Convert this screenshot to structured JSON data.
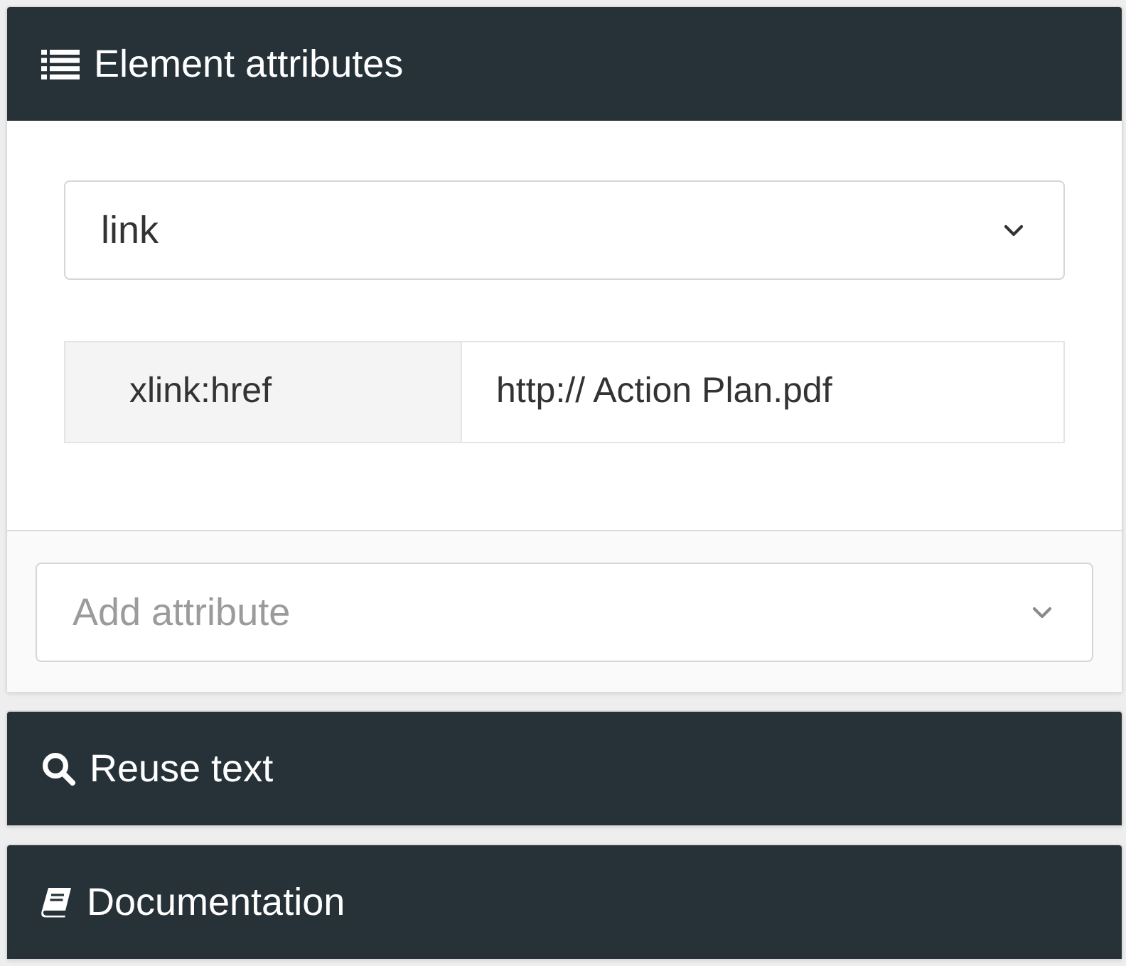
{
  "panels": [
    {
      "kind": "attributes",
      "title": "Element attributes",
      "expanded": true,
      "element_select": {
        "value": "link"
      },
      "attributes": [
        {
          "name": "xlink:href",
          "value": "http:// Action Plan.pdf"
        }
      ],
      "add_attribute": {
        "placeholder": "Add attribute"
      }
    },
    {
      "kind": "reuse",
      "title": "Reuse text",
      "expanded": false
    },
    {
      "kind": "documentation",
      "title": "Documentation",
      "expanded": false
    }
  ]
}
